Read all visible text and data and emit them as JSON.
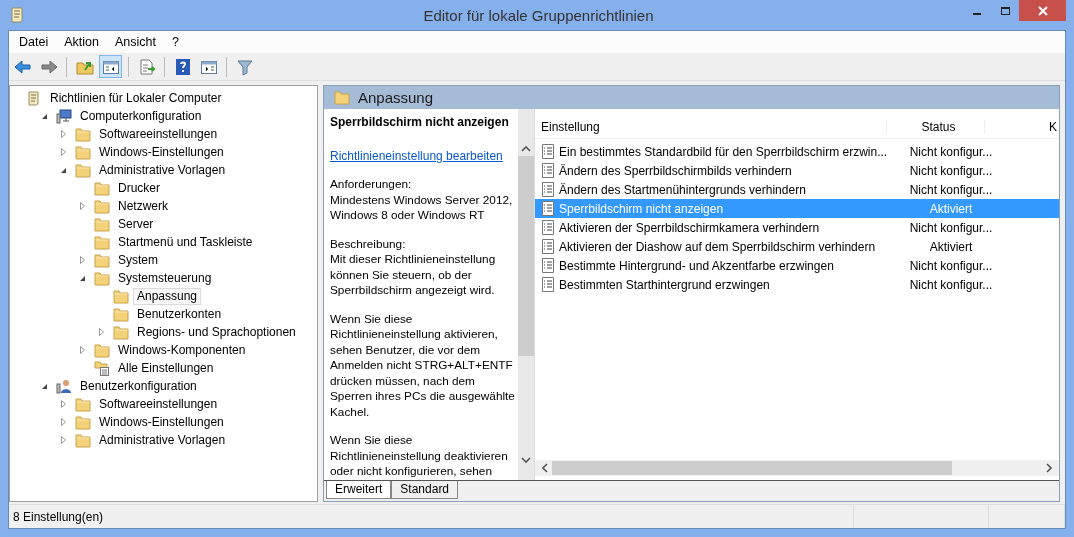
{
  "window": {
    "title": "Editor für lokale Gruppenrichtlinien"
  },
  "menu": [
    "Datei",
    "Aktion",
    "Ansicht",
    "?"
  ],
  "toolbar": [
    {
      "kind": "back",
      "pressed": false
    },
    {
      "kind": "forward",
      "pressed": false
    },
    {
      "kind": "sep"
    },
    {
      "kind": "up",
      "pressed": false
    },
    {
      "kind": "tree",
      "pressed": true
    },
    {
      "kind": "sep"
    },
    {
      "kind": "export",
      "pressed": false
    },
    {
      "kind": "sep"
    },
    {
      "kind": "help",
      "pressed": false
    },
    {
      "kind": "pane",
      "pressed": false
    },
    {
      "kind": "sep"
    },
    {
      "kind": "filter",
      "pressed": false
    }
  ],
  "tree": [
    {
      "label": "Richtlinien für Lokaler Computer",
      "kind": "root",
      "selected": false,
      "children": [
        {
          "label": "Computerkonfiguration",
          "kind": "computer",
          "selected": false,
          "expanded": true,
          "children": [
            {
              "label": "Softwareeinstellungen",
              "kind": "folder",
              "selected": false,
              "expanded": false
            },
            {
              "label": "Windows-Einstellungen",
              "kind": "folder",
              "selected": false,
              "expanded": false
            },
            {
              "label": "Administrative Vorlagen",
              "kind": "folder",
              "selected": false,
              "expanded": true,
              "children": [
                {
                  "label": "Drucker",
                  "kind": "folder",
                  "selected": false
                },
                {
                  "label": "Netzwerk",
                  "kind": "folder",
                  "selected": false,
                  "expanded": false
                },
                {
                  "label": "Server",
                  "kind": "folder",
                  "selected": false
                },
                {
                  "label": "Startmenü und Taskleiste",
                  "kind": "folder",
                  "selected": false
                },
                {
                  "label": "System",
                  "kind": "folder",
                  "selected": false,
                  "expanded": false
                },
                {
                  "label": "Systemsteuerung",
                  "kind": "folder",
                  "selected": false,
                  "expanded": true,
                  "children": [
                    {
                      "label": "Anpassung",
                      "kind": "folder",
                      "selected": true
                    },
                    {
                      "label": "Benutzerkonten",
                      "kind": "folder",
                      "selected": false
                    },
                    {
                      "label": "Regions- und Sprachoptionen",
                      "kind": "folder",
                      "selected": false,
                      "expanded": false
                    }
                  ]
                },
                {
                  "label": "Windows-Komponenten",
                  "kind": "folder",
                  "selected": false,
                  "expanded": false
                },
                {
                  "label": "Alle Einstellungen",
                  "kind": "settings",
                  "selected": false
                }
              ]
            }
          ]
        },
        {
          "label": "Benutzerkonfiguration",
          "kind": "user",
          "selected": false,
          "expanded": true,
          "children": [
            {
              "label": "Softwareeinstellungen",
              "kind": "folder",
              "selected": false,
              "expanded": false
            },
            {
              "label": "Windows-Einstellungen",
              "kind": "folder",
              "selected": false,
              "expanded": false
            },
            {
              "label": "Administrative Vorlagen",
              "kind": "folder",
              "selected": false,
              "expanded": false
            }
          ]
        }
      ]
    }
  ],
  "panel": {
    "title": "Anpassung",
    "description": {
      "title": "Sperrbildschirm nicht anzeigen",
      "link": "Richtlinieneinstellung bearbeiten",
      "paragraphs": [
        [
          "Anforderungen:",
          "Mindestens Windows Server 2012,",
          "Windows 8 oder Windows RT"
        ],
        [
          "Beschreibung:",
          "Mit dieser Richtlinieneinstellung",
          "können Sie steuern, ob der",
          "Sperrbildschirm angezeigt wird."
        ],
        [
          "Wenn Sie diese",
          "Richtlinieneinstellung aktivieren,",
          "sehen Benutzer, die vor dem",
          "Anmelden nicht STRG+ALT+ENTF",
          "drücken müssen, nach dem",
          "Sperren ihres PCs die ausgewählte",
          "Kachel."
        ],
        [
          "Wenn Sie diese",
          "Richtlinieneinstellung deaktivieren",
          "oder nicht konfigurieren, sehen"
        ]
      ]
    },
    "columns": [
      "Einstellung",
      "Status",
      "K"
    ],
    "rows": [
      {
        "name": "Ein bestimmtes Standardbild für den Sperrbildschirm erzwin...",
        "status": "Nicht konfigur...",
        "selected": false
      },
      {
        "name": "Ändern des Sperrbildschirmbilds verhindern",
        "status": "Nicht konfigur...",
        "selected": false
      },
      {
        "name": "Ändern des Startmenühintergrunds verhindern",
        "status": "Nicht konfigur...",
        "selected": false
      },
      {
        "name": "Sperrbildschirm nicht anzeigen",
        "status": "Aktiviert",
        "selected": true
      },
      {
        "name": "Aktivieren der Sperrbildschirmkamera verhindern",
        "status": "Nicht konfigur...",
        "selected": false
      },
      {
        "name": "Aktivieren der Diashow auf dem Sperrbildschirm verhindern",
        "status": "Aktiviert",
        "selected": false
      },
      {
        "name": "Bestimmte Hintergrund- und Akzentfarbe erzwingen",
        "status": "Nicht konfigur...",
        "selected": false
      },
      {
        "name": "Bestimmten Starthintergrund erzwingen",
        "status": "Nicht konfigur...",
        "selected": false
      }
    ],
    "tabs": [
      {
        "label": "Erweitert",
        "selected": true
      },
      {
        "label": "Standard",
        "selected": false
      }
    ]
  },
  "status_bar": "8 Einstellung(en)"
}
